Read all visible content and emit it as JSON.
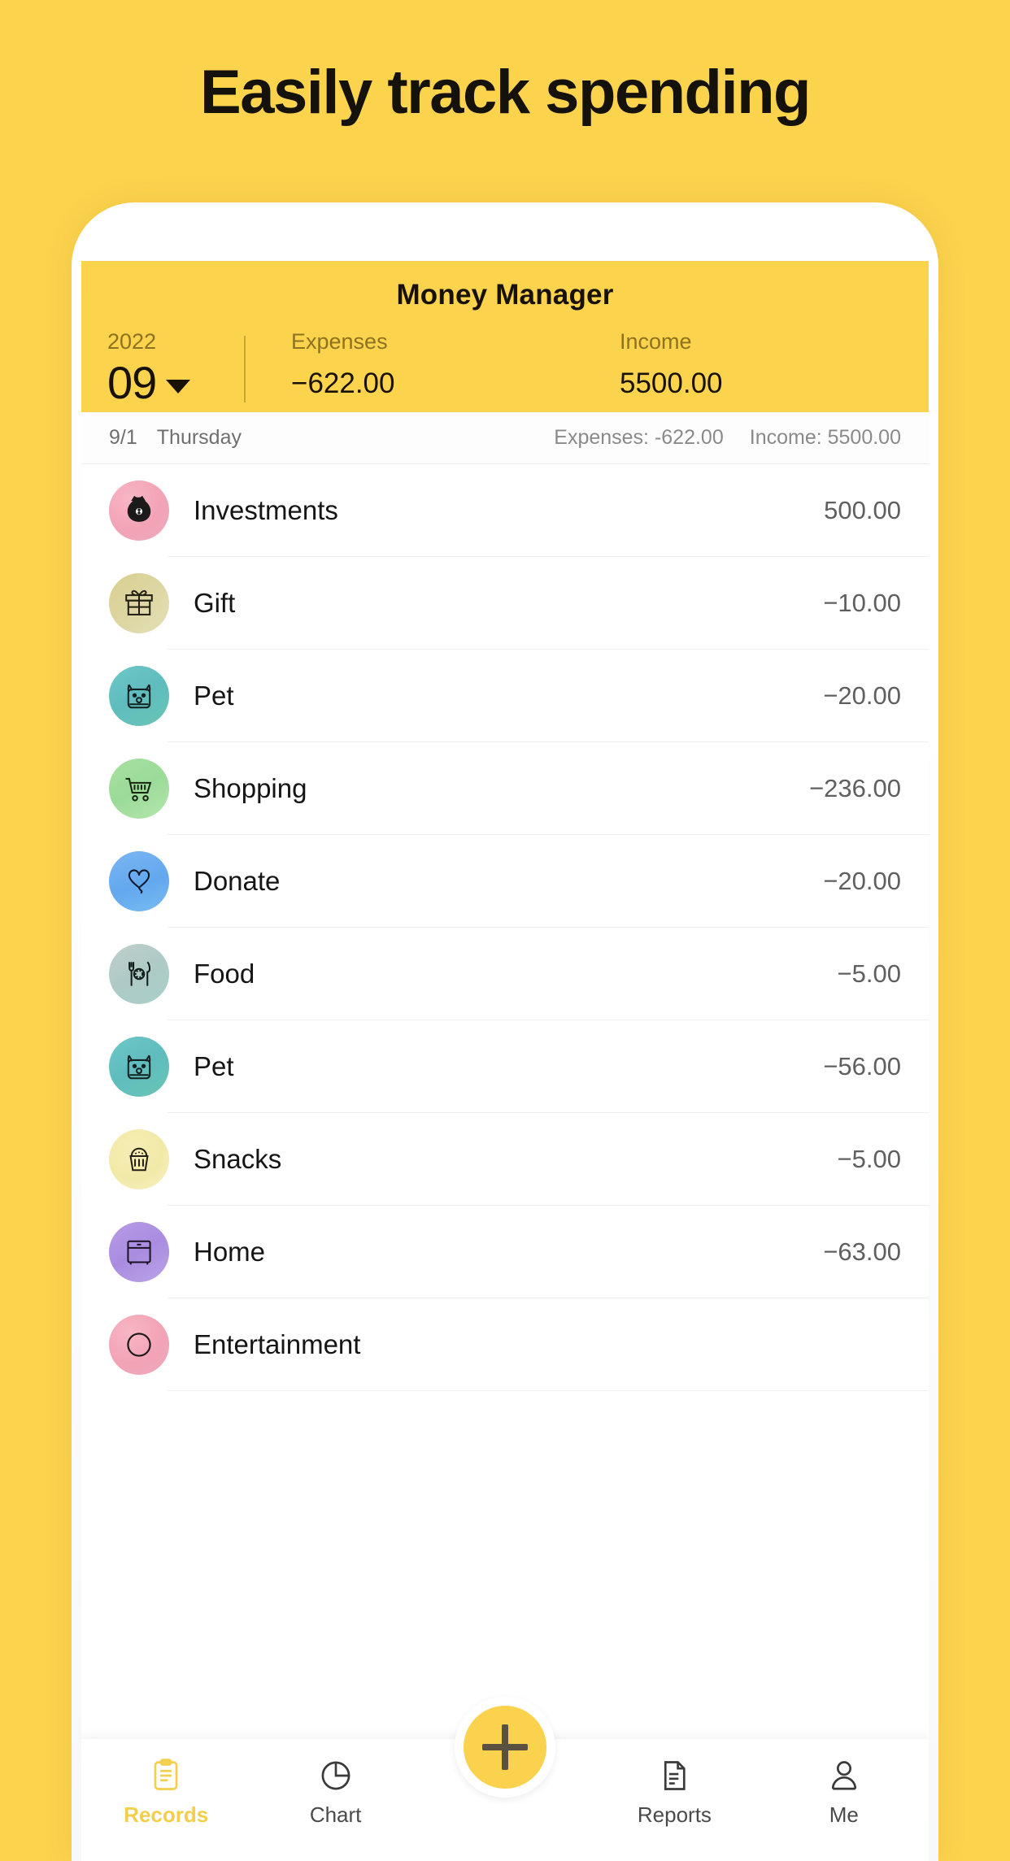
{
  "headline": "Easily track spending",
  "colors": {
    "background": "#FCD34D",
    "header": "#FCD34D",
    "accent": "#F2CE4B",
    "fab": "#FBD24E"
  },
  "app": {
    "title": "Money Manager",
    "summary": {
      "year": "2022",
      "month": "09",
      "expenses_label": "Expenses",
      "expenses_value": "−622.00",
      "income_label": "Income",
      "income_value": "5500.00"
    },
    "date_bar": {
      "date": "9/1",
      "weekday": "Thursday",
      "expenses": "Expenses: -622.00",
      "income": "Income: 5500.00"
    },
    "transactions": [
      {
        "category": "Investments",
        "amount": "500.00",
        "icon": "money-bag-icon"
      },
      {
        "category": "Gift",
        "amount": "−10.00",
        "icon": "gift-icon"
      },
      {
        "category": "Pet",
        "amount": "−20.00",
        "icon": "dog-face-icon"
      },
      {
        "category": "Shopping",
        "amount": "−236.00",
        "icon": "shopping-cart-icon"
      },
      {
        "category": "Donate",
        "amount": "−20.00",
        "icon": "heart-balloon-icon"
      },
      {
        "category": "Food",
        "amount": "−5.00",
        "icon": "cutlery-icon"
      },
      {
        "category": "Pet",
        "amount": "−56.00",
        "icon": "dog-face-icon"
      },
      {
        "category": "Snacks",
        "amount": "−5.00",
        "icon": "cupcake-icon"
      },
      {
        "category": "Home",
        "amount": "−63.00",
        "icon": "dresser-icon"
      },
      {
        "category": "Entertainment",
        "amount": "",
        "icon": "entertainment-icon"
      }
    ],
    "bottom_nav": {
      "items": [
        {
          "label": "Records",
          "icon": "clipboard-icon",
          "active": true
        },
        {
          "label": "Chart",
          "icon": "pie-chart-icon",
          "active": false
        },
        {
          "label": "Reports",
          "icon": "document-icon",
          "active": false
        },
        {
          "label": "Me",
          "icon": "person-icon",
          "active": false
        }
      ],
      "fab": {
        "icon": "plus-icon",
        "label": ""
      }
    }
  }
}
